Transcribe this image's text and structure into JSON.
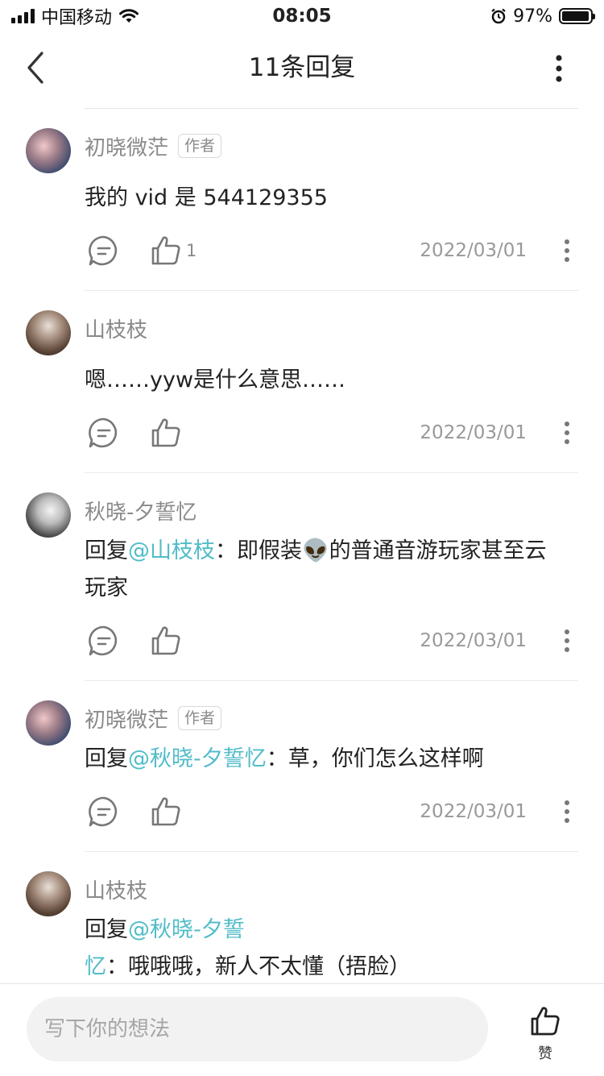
{
  "status_bar": {
    "carrier": "中国移动",
    "time": "08:05",
    "battery": "97%"
  },
  "header": {
    "title": "11条回复"
  },
  "comments": [
    {
      "name": "初晓微茫",
      "badge": "作者",
      "text": "我的 vid 是 544129355",
      "mention": "",
      "likes": "1",
      "date": "2022/03/01"
    },
    {
      "name": "山枝枝",
      "badge": "",
      "text": "嗯……yyw是什么意思……",
      "mention": "",
      "likes": "",
      "date": "2022/03/01"
    },
    {
      "name": "秋晓-夕誓忆",
      "badge": "",
      "prefix": "回复",
      "mention": "@山枝枝",
      "text_a": "：即假装",
      "emoji": "👽",
      "text_b": "的普通音游玩家甚至云玩家",
      "likes": "",
      "date": "2022/03/01"
    },
    {
      "name": "初晓微茫",
      "badge": "作者",
      "prefix": "回复",
      "mention": "@秋晓-夕誓忆",
      "text": "：草，你们怎么这样啊",
      "likes": "",
      "date": "2022/03/01"
    },
    {
      "name": "山枝枝",
      "badge": "",
      "prefix": "回复",
      "mention": "@秋晓-夕誓忆",
      "text": "：哦哦哦，新人不太懂（捂脸）",
      "likes": ""
    }
  ],
  "bottom_bar": {
    "input_placeholder": "写下你的想法",
    "like_label": "赞"
  },
  "colors": {
    "mention": "#52bcc8",
    "secondary_text": "#8a8a8a"
  },
  "icons": [
    "back-chevron-icon",
    "more-vertical-icon",
    "reply-bubble-icon",
    "thumbs-up-icon",
    "alarm-icon",
    "wifi-icon"
  ]
}
